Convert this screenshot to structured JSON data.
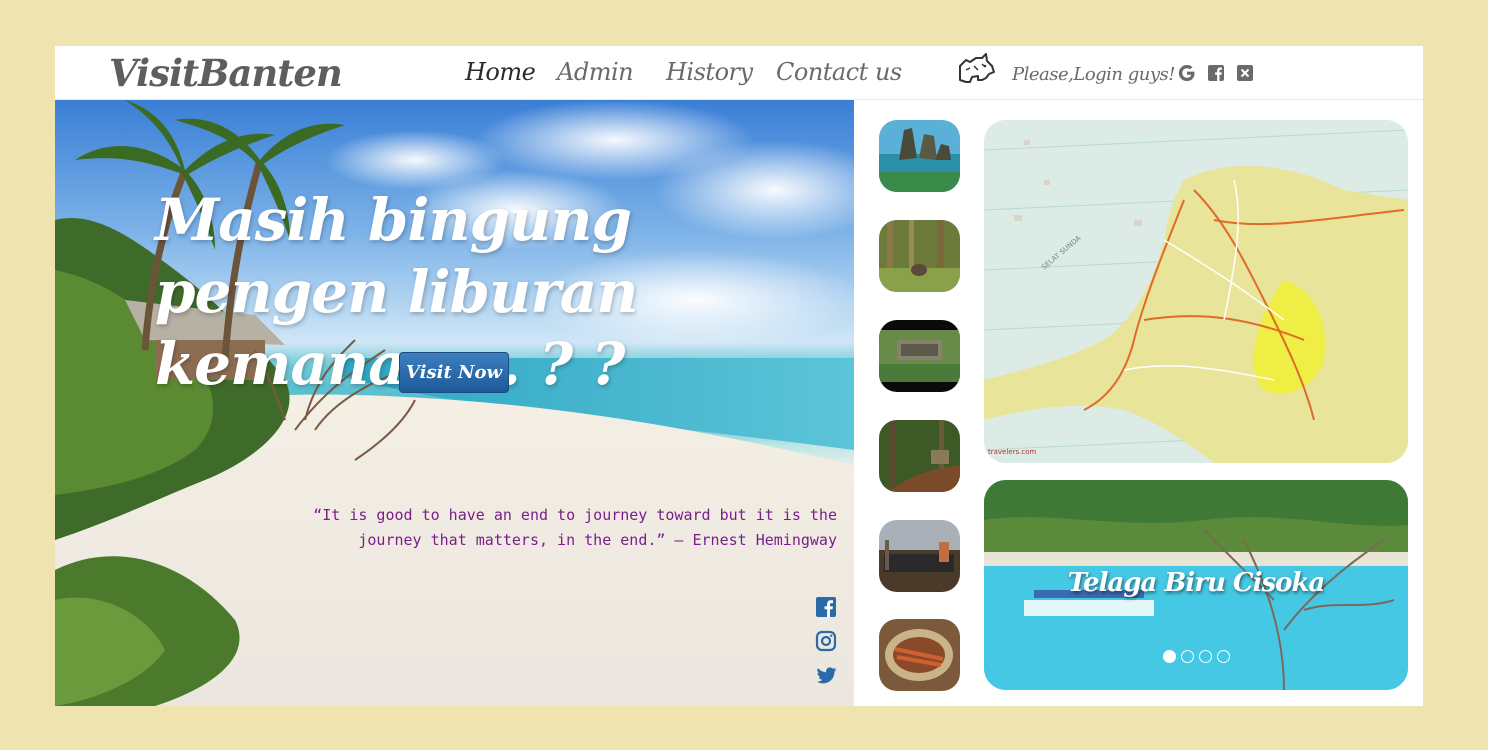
{
  "navbar": {
    "brand": "VisitBanten",
    "items": [
      {
        "label": "Home",
        "active": true
      },
      {
        "label": "Admin",
        "active": false
      },
      {
        "label": "History",
        "active": false
      },
      {
        "label": "Contact us",
        "active": false
      }
    ],
    "login_text": "Please,Login guys!",
    "login_icons": [
      "google-icon",
      "facebook-icon",
      "x-icon"
    ]
  },
  "hero": {
    "title": "Masih bingung pengen liburan kemana . . . ? ?",
    "button_label": "Visit Now",
    "quote": "“It is good to have an end to journey toward but it is the journey that matters, in the end.” — Ernest Hemingway",
    "social_icons": [
      "facebook-icon",
      "instagram-icon",
      "twitter-icon"
    ]
  },
  "thumbnails": [
    {
      "name": "rock-island"
    },
    {
      "name": "forest-rhino"
    },
    {
      "name": "ruins"
    },
    {
      "name": "jungle-path"
    },
    {
      "name": "market-stall"
    },
    {
      "name": "sate-food"
    }
  ],
  "map": {
    "watermark": "travelers.com"
  },
  "carousel": {
    "caption": "Telaga Biru Cisoka",
    "slides": 4,
    "active_slide": 0
  },
  "colors": {
    "page_background": "#efe4b0",
    "button": "#2a6aa8",
    "quote_text": "#7a1e8b",
    "icon_blue": "#2a6aa8"
  }
}
